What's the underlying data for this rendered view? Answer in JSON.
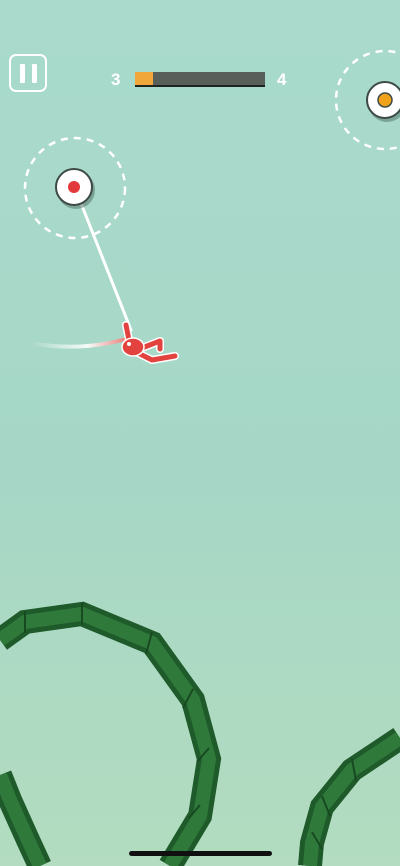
{
  "hud": {
    "level_current": "3",
    "level_next": "4",
    "progress": 0.14,
    "progress_color": "#f2a73a"
  },
  "pause_icon": "pause-icon",
  "colors": {
    "background": "#a9dacc",
    "player": "#e2433f",
    "pivot_active": "#e23a3a",
    "pivot_inactive": "#f0a21a",
    "track": "#2f7a3b",
    "track_dark": "#1f5a2a"
  }
}
